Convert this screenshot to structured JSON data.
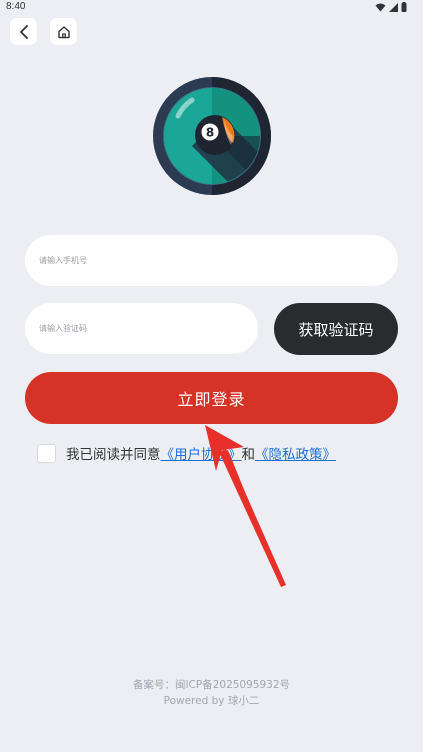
{
  "status_bar": {
    "time": "8:40"
  },
  "nav": {
    "back_icon": "chevron-left-icon",
    "home_icon": "home-icon"
  },
  "logo": {
    "icon": "billiard-8-ball-icon",
    "ball_number": "8",
    "colors": {
      "outer": "#2c3a52",
      "ring": "#3d6e84",
      "teal": "#1ba797",
      "ball": "#1f2430",
      "stripe": "#f07a1a"
    }
  },
  "form": {
    "phone_placeholder": "请输入手机号",
    "code_placeholder": "请输入验证码",
    "get_code_label": "获取验证码",
    "login_label": "立即登录"
  },
  "agreement": {
    "prefix": "我已阅读并同意",
    "user_agreement": "《用户协议》",
    "conjunction": "和",
    "privacy_policy": "《隐私政策》"
  },
  "footer": {
    "icp": "备案号：闽ICP备2025095932号",
    "powered_by": "Powered by 球小二"
  },
  "colors": {
    "accent": "#d63227",
    "dark_button": "#2a2b2f",
    "link": "#1c6fd6",
    "background": "#eceef3"
  }
}
